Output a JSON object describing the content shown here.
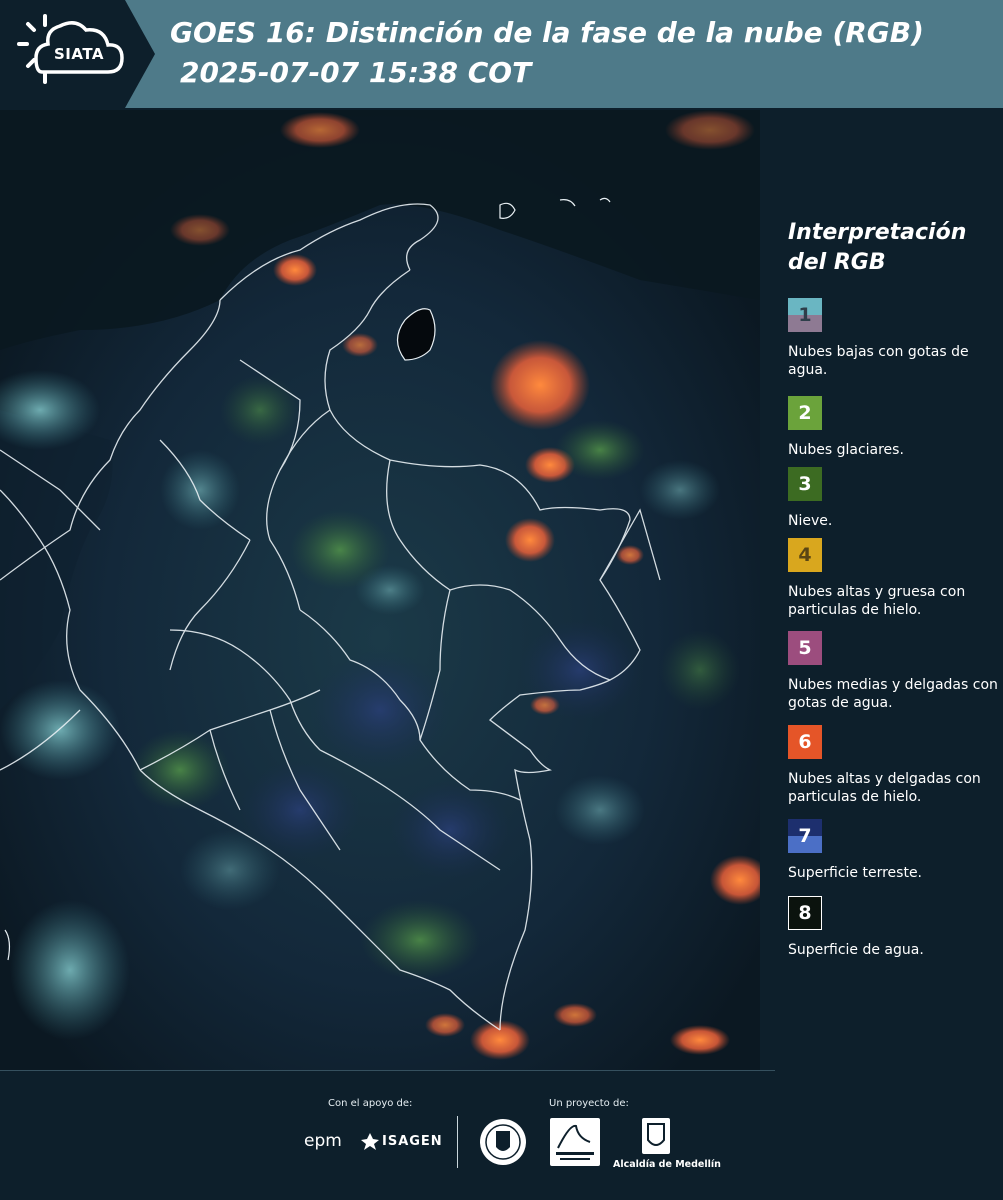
{
  "header": {
    "logo_text": "SIATA",
    "title": "GOES 16: Distinción de la fase de la nube (RGB)",
    "subtitle": "2025-07-07 15:38 COT"
  },
  "legend": {
    "title": "Interpretación del RGB",
    "items": [
      {
        "num": "1",
        "label": "Nubes bajas con gotas de agua.",
        "color_top": "#6ab6c2",
        "color_bottom": "#8e7a93"
      },
      {
        "num": "2",
        "label": "Nubes glaciares.",
        "color": "#6ba33b"
      },
      {
        "num": "3",
        "label": "Nieve.",
        "color": "#3c6b22"
      },
      {
        "num": "4",
        "label": "Nubes altas y gruesa con particulas de hielo.",
        "color": "#d9a71e"
      },
      {
        "num": "5",
        "label": "Nubes medias y delgadas con gotas de agua.",
        "color": "#9c4d7e"
      },
      {
        "num": "6",
        "label": "Nubes altas y delgadas con particulas de hielo.",
        "color": "#e55528"
      },
      {
        "num": "7",
        "label": "Superficie terreste.",
        "color_top": "#1d2f6e",
        "color_bottom": "#4b6fc6"
      },
      {
        "num": "8",
        "label": "Superficie de agua.",
        "color": "#0b130e"
      }
    ]
  },
  "footer": {
    "support_label": "Con el apoyo de:",
    "project_label": "Un proyecto de:",
    "epm": "epm",
    "isagen": "ISAGEN",
    "alcaldia": "Alcaldía de Medellín"
  }
}
